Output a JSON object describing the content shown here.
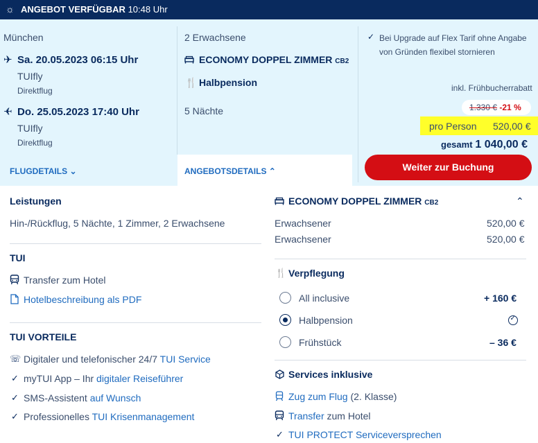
{
  "banner": {
    "title": "ANGEBOT VERFÜGBAR",
    "time": "10:48 Uhr"
  },
  "flight": {
    "origin": "München",
    "outbound": {
      "date": "Sa. 20.05.2023 06:15 Uhr",
      "airline": "TUIfly",
      "type": "Direktflug"
    },
    "inbound": {
      "date": "Do. 25.05.2023 17:40 Uhr",
      "airline": "TUIfly",
      "type": "Direktflug"
    },
    "details_link": "FLUGDETAILS"
  },
  "offer": {
    "travellers": "2 Erwachsene",
    "room": "ECONOMY DOPPEL ZIMMER",
    "room_code": "CB2",
    "board": "Halbpension",
    "nights": "5 Nächte",
    "details_tab": "ANGEBOTSDETAILS"
  },
  "price": {
    "upgrade_note": "Bei Upgrade auf Flex Tarif ohne Angabe von Gründen flexibel stornieren",
    "discount_label": "inkl. Frühbucherrabatt",
    "old_price": "1.330 €",
    "discount_pct": "-21 %",
    "per_person_label": "pro Person",
    "per_person_value": "520,00 €",
    "total_label": "gesamt",
    "total_value": "1 040,00 €",
    "cta": "Weiter zur Buchung"
  },
  "details": {
    "services_heading": "Leistungen",
    "services_text": "Hin-/Rückflug, 5 Nächte, 1 Zimmer, 2 Erwachsene",
    "tui_heading": "TUI",
    "transfer": "Transfer zum Hotel",
    "hotel_pdf": "Hotelbeschreibung als PDF",
    "vorteile_heading": "TUI VORTEILE",
    "vorteile": [
      {
        "plain": "Digitaler und telefonischer 24/7 ",
        "link": "TUI Service"
      },
      {
        "plain": "myTUI App – Ihr ",
        "link": "digitaler Reiseführer"
      },
      {
        "plain": "SMS-Assistent ",
        "link": "auf Wunsch"
      },
      {
        "plain": "Professionelles ",
        "link": "TUI Krisenmanagement"
      }
    ]
  },
  "room_panel": {
    "title": "ECONOMY DOPPEL ZIMMER",
    "code": "CB2",
    "rows": [
      {
        "label": "Erwachsener",
        "value": "520,00 €"
      },
      {
        "label": "Erwachsener",
        "value": "520,00 €"
      }
    ],
    "board_heading": "Verpflegung",
    "board_options": [
      {
        "label": "All inclusive",
        "value": "+ 160 €",
        "selected": false
      },
      {
        "label": "Halbpension",
        "value": "",
        "selected": true
      },
      {
        "label": "Frühstück",
        "value": "– 36 €",
        "selected": false
      }
    ],
    "included_heading": "Services inklusive",
    "included": [
      {
        "link": "Zug zum Flug",
        "plain": " (2. Klasse)"
      },
      {
        "link": "Transfer",
        "plain": " zum Hotel"
      },
      {
        "link": "TUI PROTECT",
        "plain": " Serviceversprechen"
      }
    ]
  },
  "colors": {
    "navy": "#092a5e",
    "summary_bg": "#e3f5fd",
    "cta": "#d40e14",
    "link": "#1f6bbf",
    "highlight": "#ffff2a"
  }
}
